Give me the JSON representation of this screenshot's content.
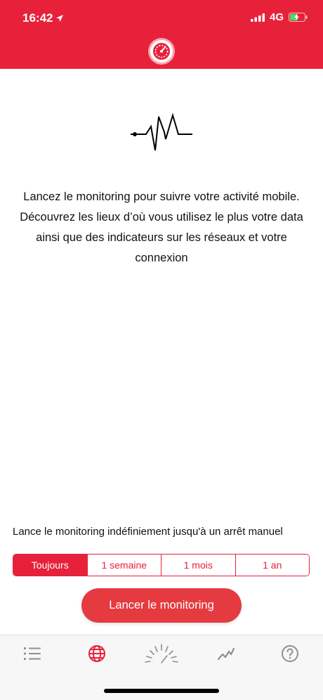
{
  "status_bar": {
    "time": "16:42",
    "network": "4G"
  },
  "colors": {
    "brand_red": "#E8213B",
    "button_red": "#E53A40",
    "tab_active": "#E8213B",
    "tab_inactive": "#8E8E93"
  },
  "header": {
    "logo_icon": "speedometer-icon"
  },
  "main": {
    "illustration_icon": "heartbeat-pulse-icon",
    "intro_text": "Lancez le monitoring pour suivre votre activité mobile. Découvrez les lieux d’où vous utilisez le plus votre data ainsi que des indicateurs sur les réseaux et votre connexion",
    "duration_description": "Lance le monitoring indéfiniement jusqu'à un arrêt manuel",
    "duration_options": [
      {
        "label": "Toujours",
        "selected": true
      },
      {
        "label": "1 semaine",
        "selected": false
      },
      {
        "label": "1 mois",
        "selected": false
      },
      {
        "label": "1 an",
        "selected": false
      }
    ],
    "start_button_label": "Lancer le monitoring"
  },
  "tab_bar": {
    "items": [
      {
        "icon": "list-icon",
        "active": false
      },
      {
        "icon": "globe-icon",
        "active": true
      },
      {
        "icon": "speed-gauge-icon",
        "active": false
      },
      {
        "icon": "line-chart-icon",
        "active": false
      },
      {
        "icon": "help-icon",
        "active": false
      }
    ]
  }
}
